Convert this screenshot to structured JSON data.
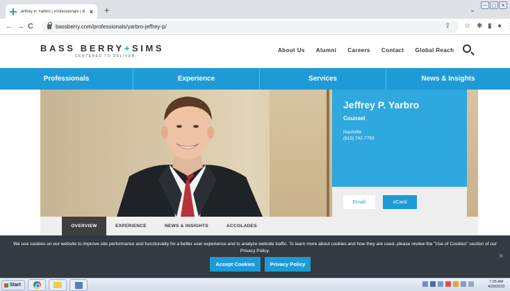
{
  "browser": {
    "tab_title": "Jeffrey P. Yarbro | Professionals | B",
    "tab_close": "×",
    "new_tab": "+",
    "url": "bassberry.com/professionals/yarbro-jeffrey-p/",
    "back": "←",
    "forward": "→",
    "reload": "C",
    "minimize": "—",
    "restore": "▢",
    "close": "✕",
    "chevron": "⌄"
  },
  "site": {
    "logo_left": "BASS BERRY",
    "logo_plus": "+",
    "logo_right": "SIMS",
    "logo_tagline": "CENTERED TO DELIVER.",
    "top_nav": [
      "About Us",
      "Alumni",
      "Careers",
      "Contact",
      "Global Reach"
    ]
  },
  "main_nav": [
    "Professionals",
    "Experience",
    "Services",
    "News & Insights"
  ],
  "profile": {
    "name": "Jeffrey P. Yarbro",
    "title": "Counsel",
    "city": "Nashville",
    "phone": "(615) 742-7793",
    "email_label": "Email",
    "vcard_label": "vCard"
  },
  "sub_tabs": [
    "OVERVIEW",
    "EXPERIENCE",
    "NEWS & INSIGHTS",
    "ACCOLADES"
  ],
  "cookie": {
    "text": "We use cookies on our website to improve site performance and functionality for a better user experience and to analyze website traffic. To learn more about cookies and how they are used, please review the \"Use of Cookies\" section of our Privacy Policy.",
    "accept_label": "Accept Cookies",
    "privacy_label": "Privacy Policy",
    "close": "×"
  },
  "taskbar": {
    "start_label": "Start",
    "time": "7:25 AM",
    "date": "4/29/2023"
  },
  "colors": {
    "brand_blue": "#1e9bd7",
    "card_blue": "#2fa7df",
    "cookie_bg": "#333a41"
  }
}
